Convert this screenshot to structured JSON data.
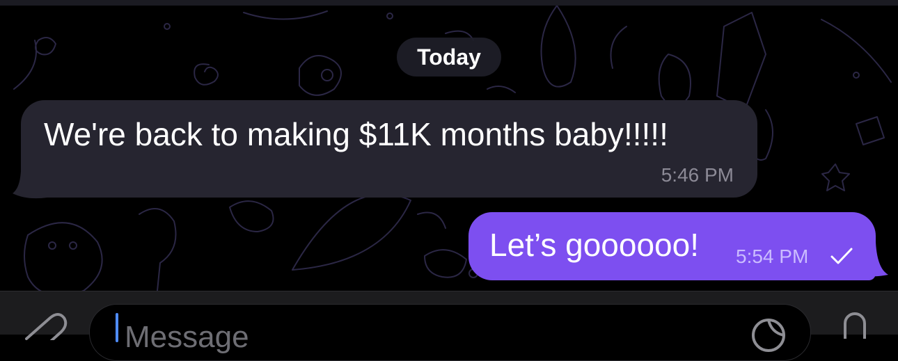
{
  "date_separator": "Today",
  "messages": [
    {
      "direction": "incoming",
      "text": "We're back to making $11K months baby!!!!!",
      "time": "5:46 PM"
    },
    {
      "direction": "outgoing",
      "text": "Let’s goooooo!",
      "time": "5:54 PM",
      "status_icon": "single-check-icon"
    }
  ],
  "composer": {
    "placeholder": "Message"
  },
  "icons": [
    "attach-paperclip-icon",
    "sticker-icon",
    "microphone-icon"
  ],
  "colors": {
    "background": "#000000",
    "incoming_bubble": "#262530",
    "outgoing_bubble": "#7d4ff0",
    "doodle_stroke": "#2b2745",
    "timestamp_in": "#8c8a96",
    "timestamp_out": "#cbbcff",
    "cursor": "#4f8cff"
  }
}
